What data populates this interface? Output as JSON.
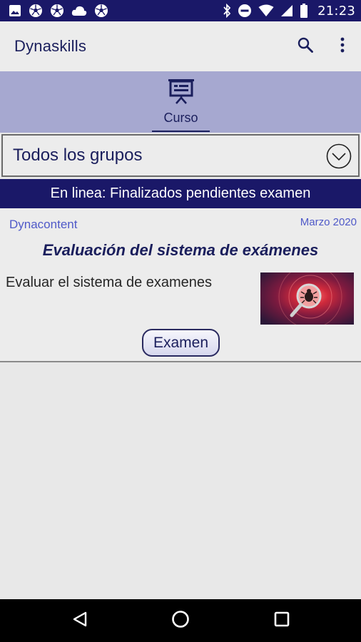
{
  "status_bar": {
    "time": "21:23",
    "left_icons": [
      "image-icon",
      "soccer-ball-icon",
      "soccer-ball-icon",
      "cloud-icon",
      "soccer-ball-icon"
    ],
    "right_icons": [
      "bluetooth-icon",
      "do-not-disturb-icon",
      "wifi-icon",
      "signal-icon",
      "battery-icon"
    ]
  },
  "app_bar": {
    "title": "Dynaskills",
    "actions": [
      "search-icon",
      "more-vert-icon"
    ]
  },
  "tabs": [
    {
      "label": "Curso",
      "icon": "presentation-icon",
      "selected": true
    }
  ],
  "group_filter": {
    "selected": "Todos los grupos",
    "icon": "chevron-down-circle-icon"
  },
  "banner": {
    "text": "En linea: Finalizados pendientes examen"
  },
  "courses": [
    {
      "source": "Dynacontent",
      "date": "Marzo 2020",
      "title": "Evaluación del sistema de exámenes",
      "description": "Evaluar el sistema de examenes",
      "thumbnail": "magnifier-bug-image",
      "button_label": "Examen"
    }
  ],
  "nav_bar": [
    "back-icon",
    "home-icon",
    "recents-icon"
  ],
  "colors": {
    "primary_dark": "#1a1868",
    "tab_background": "#a6a8d0",
    "accent_text": "#4f59c8",
    "title_text": "#1a1e5c",
    "background": "#e8e8e8"
  }
}
